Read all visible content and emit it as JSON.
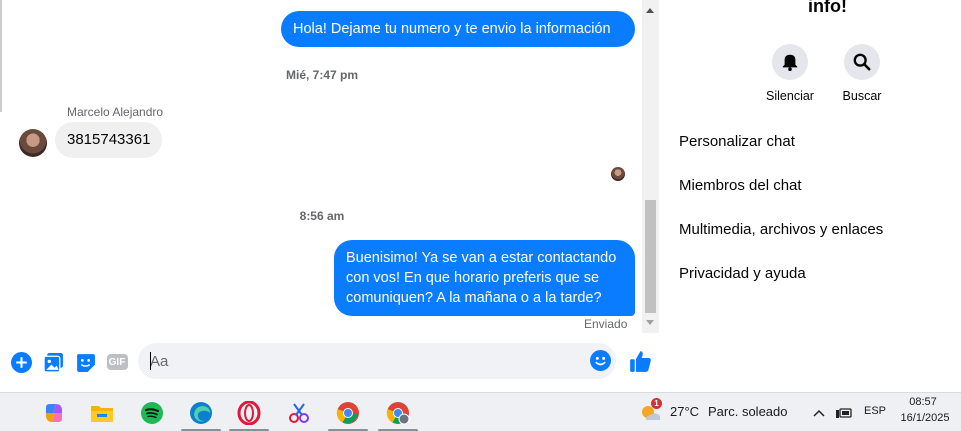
{
  "messages": {
    "out1": "Hola! Dejame tu numero y te envio la información",
    "time1": "Mié, 7:47 pm",
    "sender_name": "Marcelo Alejandro",
    "in1": "3815743361",
    "time2": "8:56 am",
    "out2": "Buenisimo! Ya se van a estar contactando con vos! En que horario preferis que se comuniquen? A la mañana o a la tarde?",
    "status": "Enviado"
  },
  "composer": {
    "placeholder": "Aa",
    "gif_label": "GIF",
    "icons": [
      "add-circle-icon",
      "photo-icon",
      "sticker-icon",
      "gif-icon",
      "emoji-icon",
      "like-icon"
    ]
  },
  "info": {
    "title": "info!",
    "actions": [
      {
        "label": "Silenciar",
        "icon": "bell-icon"
      },
      {
        "label": "Buscar",
        "icon": "search-icon"
      }
    ],
    "menu": [
      "Personalizar chat",
      "Miembros del chat",
      "Multimedia, archivos y enlaces",
      "Privacidad y ayuda"
    ]
  },
  "taskbar": {
    "apps": [
      "widgets-icon",
      "copilot-icon",
      "file-explorer-icon",
      "spotify-icon",
      "edge-icon",
      "opera-icon",
      "snipping-tool-icon",
      "chrome-icon",
      "chrome-profile-icon"
    ],
    "weather_temp": "27°C",
    "weather_desc": "Parc. soleado",
    "weather_badge": "1",
    "language": "ESP",
    "time": "08:57",
    "date": "16/1/2025"
  },
  "colors": {
    "accent": "#0a7cff",
    "incoming_bubble": "#f0f0f0",
    "muted_text": "#65676b"
  }
}
